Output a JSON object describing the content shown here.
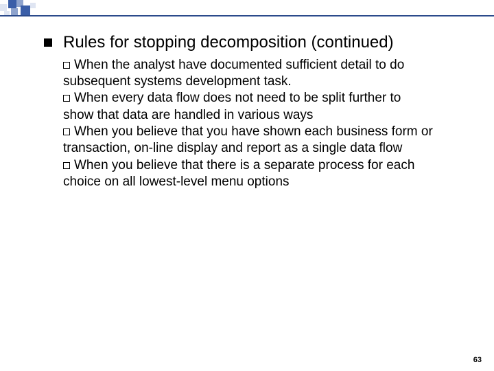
{
  "slide": {
    "title": "Rules for stopping decomposition (continued)",
    "sub": {
      "s1": "When the analyst have documented sufficient detail to do subsequent systems development task.",
      "s2": "When every data flow does not need to be split further to show that data are handled in various ways",
      "s3": "When you believe that you have shown each business form or transaction, on-line display and report as a single data flow",
      "s4": "When you believe that there is a separate process for each choice on all lowest-level menu options"
    },
    "page": "63"
  }
}
